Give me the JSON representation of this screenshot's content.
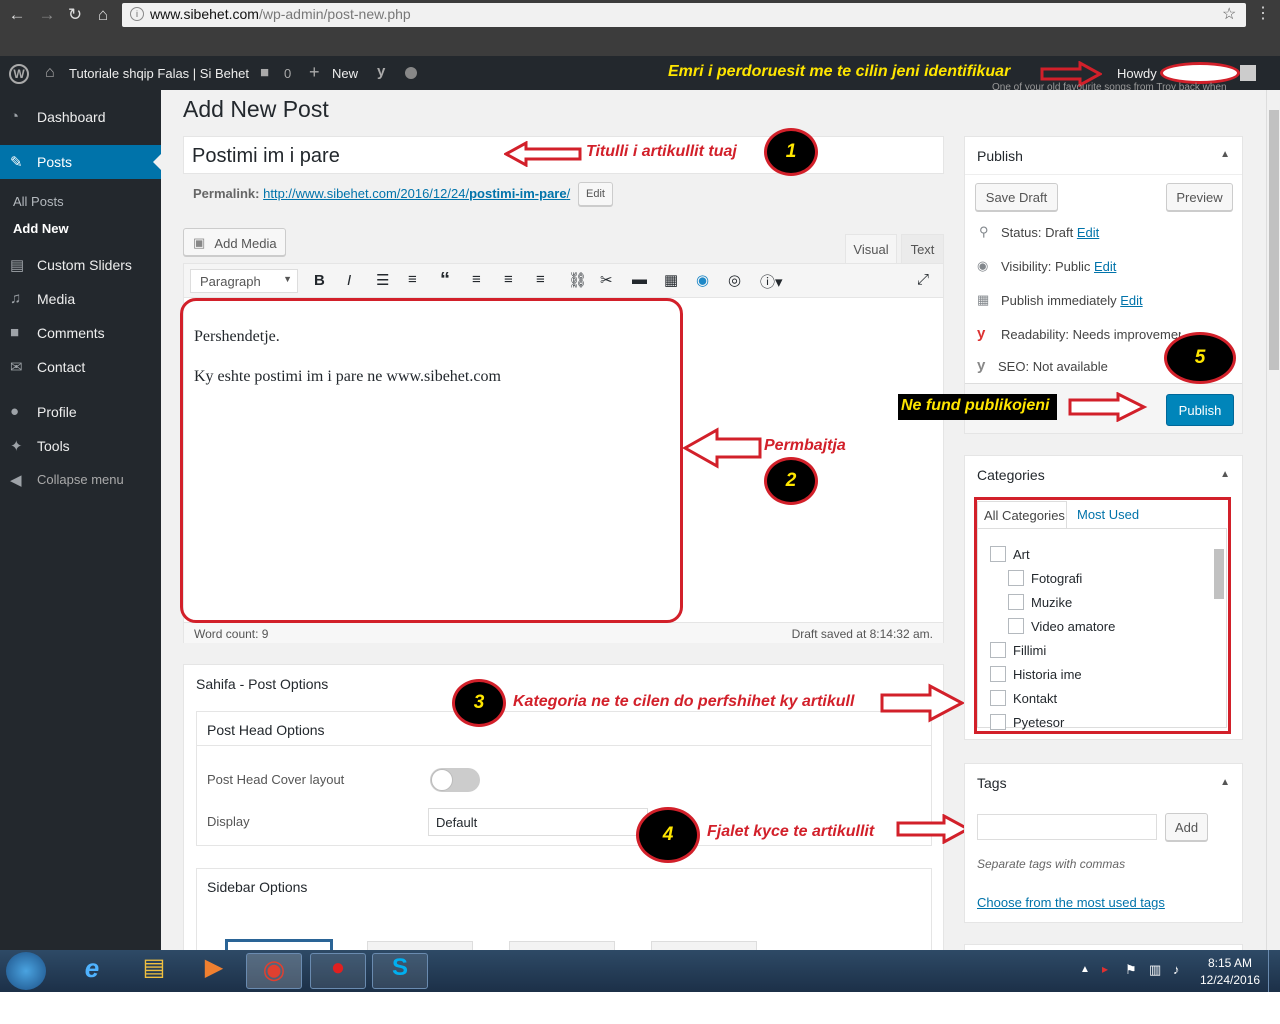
{
  "browser": {
    "url_host": "www.sibehet.com",
    "url_path": "/wp-admin/post-new.php"
  },
  "adminbar": {
    "site_name": "Tutoriale shqip Falas | Si Behet",
    "comments_count": "0",
    "new_label": "New",
    "howdy": "Howdy",
    "annotation_user": "Emri i perdoruesit me te cilin jeni identifikuar",
    "quote_snippet": "One of your old favourite songs from Troy back when"
  },
  "sidebar": {
    "items": [
      {
        "label": "Dashboard",
        "icon": "dashboard-icon"
      },
      {
        "label": "Posts",
        "icon": "pin-icon"
      },
      {
        "label": "Custom Sliders",
        "icon": "slider-icon"
      },
      {
        "label": "Media",
        "icon": "media-icon"
      },
      {
        "label": "Comments",
        "icon": "comment-icon"
      },
      {
        "label": "Contact",
        "icon": "mail-icon"
      },
      {
        "label": "Profile",
        "icon": "user-icon"
      },
      {
        "label": "Tools",
        "icon": "wrench-icon"
      },
      {
        "label": "Collapse menu",
        "icon": "collapse-icon"
      }
    ],
    "sub": {
      "all_posts": "All Posts",
      "add_new": "Add New"
    }
  },
  "page": {
    "heading": "Add New Post",
    "title_value": "Postimi im i pare",
    "permalink_label": "Permalink:",
    "permalink_url": "http://www.sibehet.com/2016/12/24/",
    "permalink_slug": "postimi-im-pare",
    "permalink_end": "/",
    "edit_btn": "Edit"
  },
  "editor": {
    "add_media": "Add Media",
    "tab_visual": "Visual",
    "tab_text": "Text",
    "format": "Paragraph",
    "line1": "Pershendetje.",
    "line2": "Ky eshte postimi im i pare ne www.sibehet.com",
    "word_count": "Word count: 9",
    "draft_saved": "Draft saved at 8:14:32 am."
  },
  "sahifa": {
    "title": "Sahifa - Post Options",
    "head_options": "Post Head Options",
    "cover_layout": "Post Head Cover layout",
    "display_label": "Display",
    "display_value": "Default",
    "sidebar_options": "Sidebar Options"
  },
  "publish": {
    "title": "Publish",
    "save_draft": "Save Draft",
    "preview": "Preview",
    "status_label": "Status:",
    "status_value": "Draft",
    "visibility_label": "Visibility:",
    "visibility_value": "Public",
    "publish_label": "Publish",
    "publish_value": "immediately",
    "edit": "Edit",
    "readability_label": "Readability:",
    "readability_value": "Needs improvement",
    "seo_label": "SEO:",
    "seo_value": "Not available",
    "publish_btn": "Publish"
  },
  "categories": {
    "title": "Categories",
    "tab_all": "All Categories",
    "tab_most": "Most Used",
    "items": [
      "Art",
      "Fotografi",
      "Muzike",
      "Video amatore",
      "Fillimi",
      "Historia ime",
      "Kontakt",
      "Pyetesor"
    ]
  },
  "tags": {
    "title": "Tags",
    "add_btn": "Add",
    "hint": "Separate tags with commas",
    "choose_link": "Choose from the most used tags"
  },
  "annotations": {
    "a1": "Titulli i artikullit tuaj",
    "a2": "Permbajtja",
    "a3": "Kategoria ne te cilen do perfshihet ky artikull",
    "a4": "Fjalet kyce te artikullit",
    "a5": "Ne fund publikojeni",
    "n1": "1",
    "n2": "2",
    "n3": "3",
    "n4": "4",
    "n5": "5"
  },
  "clock": {
    "time": "8:15 AM",
    "date": "12/24/2016"
  },
  "colors": {
    "admin_dark": "#23282d",
    "wp_blue": "#0073aa",
    "annotation_red": "#d2202a",
    "annotation_yellow": "#ffe600"
  }
}
